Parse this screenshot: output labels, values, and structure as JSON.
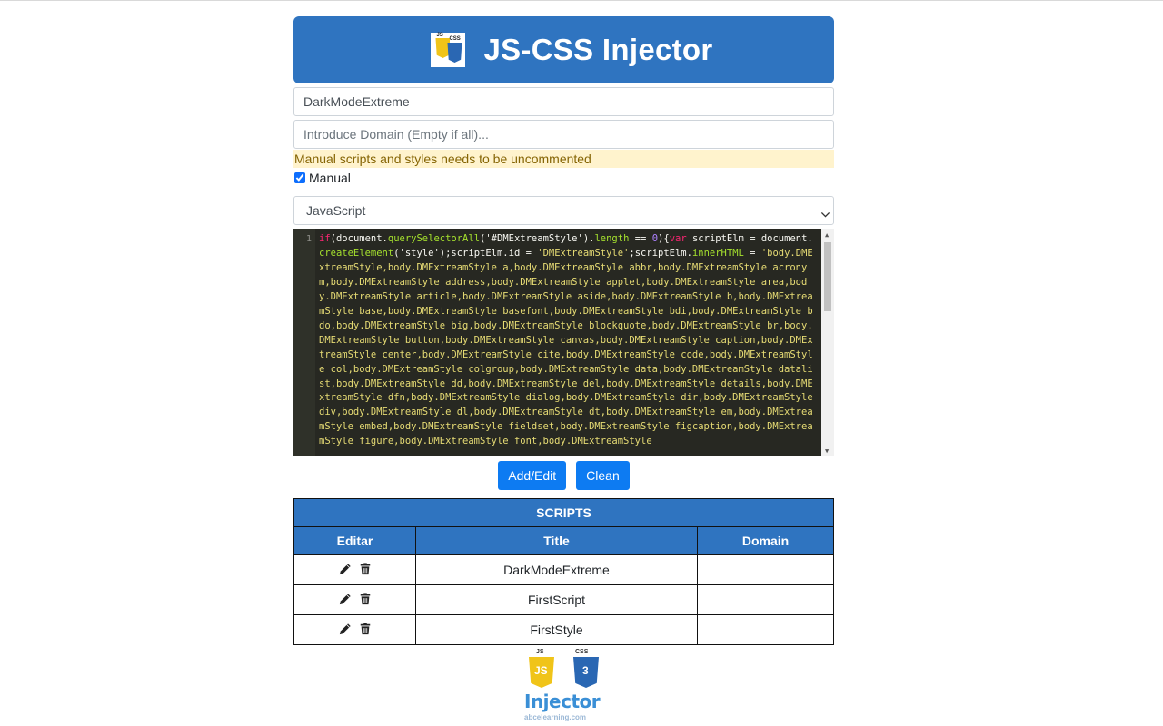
{
  "header": {
    "title": "JS-CSS Injector",
    "logo_js": "JS",
    "logo_css": "CSS"
  },
  "form": {
    "name_value": "DarkModeExtreme",
    "domain_placeholder": "Introduce Domain (Empty if all)...",
    "warning": "Manual scripts and styles needs to be uncommented",
    "manual_label": "Manual",
    "manual_checked": true,
    "type_selected": "JavaScript"
  },
  "editor": {
    "line_number": "1",
    "code_prefix_kw": "if",
    "code_prefix": "(document.",
    "code_fn1": "querySelectorAll",
    "code_arg1": "('#DMExtreamStyle')",
    "code_dot_len": ".",
    "code_length": "length",
    "code_eq": " == ",
    "code_zero": "0",
    "code_open": "){",
    "code_var": "var",
    "code_varname": " scriptElm",
    "code_assign": " = document.",
    "code_fn2": "createElement",
    "code_arg2": "('style')",
    "code_id": ";scriptElm.id = ",
    "code_idval": "'DMExtreamStyle'",
    "code_inner": ";scriptElm.",
    "code_innerHTML": "innerHTML",
    "code_eq2": " = ",
    "code_string": "'body.DMExtreamStyle,body.DMExtreamStyle a,body.DMExtreamStyle abbr,body.DMExtreamStyle acronym,body.DMExtreamStyle address,body.DMExtreamStyle applet,body.DMExtreamStyle area,body.DMExtreamStyle article,body.DMExtreamStyle aside,body.DMExtreamStyle b,body.DMExtreamStyle base,body.DMExtreamStyle basefont,body.DMExtreamStyle bdi,body.DMExtreamStyle bdo,body.DMExtreamStyle big,body.DMExtreamStyle blockquote,body.DMExtreamStyle br,body.DMExtreamStyle button,body.DMExtreamStyle canvas,body.DMExtreamStyle caption,body.DMExtreamStyle center,body.DMExtreamStyle cite,body.DMExtreamStyle code,body.DMExtreamStyle col,body.DMExtreamStyle colgroup,body.DMExtreamStyle data,body.DMExtreamStyle datalist,body.DMExtreamStyle dd,body.DMExtreamStyle del,body.DMExtreamStyle details,body.DMExtreamStyle dfn,body.DMExtreamStyle dialog,body.DMExtreamStyle dir,body.DMExtreamStyle div,body.DMExtreamStyle dl,body.DMExtreamStyle dt,body.DMExtreamStyle em,body.DMExtreamStyle embed,body.DMExtreamStyle fieldset,body.DMExtreamStyle figcaption,body.DMExtreamStyle figure,body.DMExtreamStyle font,body.DMExtreamStyle"
  },
  "buttons": {
    "add_edit": "Add/Edit",
    "clean": "Clean"
  },
  "table": {
    "caption": "SCRIPTS",
    "headers": [
      "Editar",
      "Title",
      "Domain"
    ],
    "rows": [
      {
        "title": "DarkModeExtreme",
        "domain": ""
      },
      {
        "title": "FirstScript",
        "domain": ""
      },
      {
        "title": "FirstStyle",
        "domain": ""
      }
    ]
  },
  "footer": {
    "js_tag": "JS",
    "css_tag": "CSS",
    "js_letters": "JS",
    "css_letters": "3",
    "brand": "Injector",
    "site": "abcelearning.com"
  },
  "colors": {
    "header_bg": "#2f74c0",
    "button_bg": "#0d7bf2",
    "warning_bg": "#fff3cd",
    "editor_bg": "#272822",
    "js_yellow": "#f0c419",
    "css_blue": "#2a67b3"
  }
}
